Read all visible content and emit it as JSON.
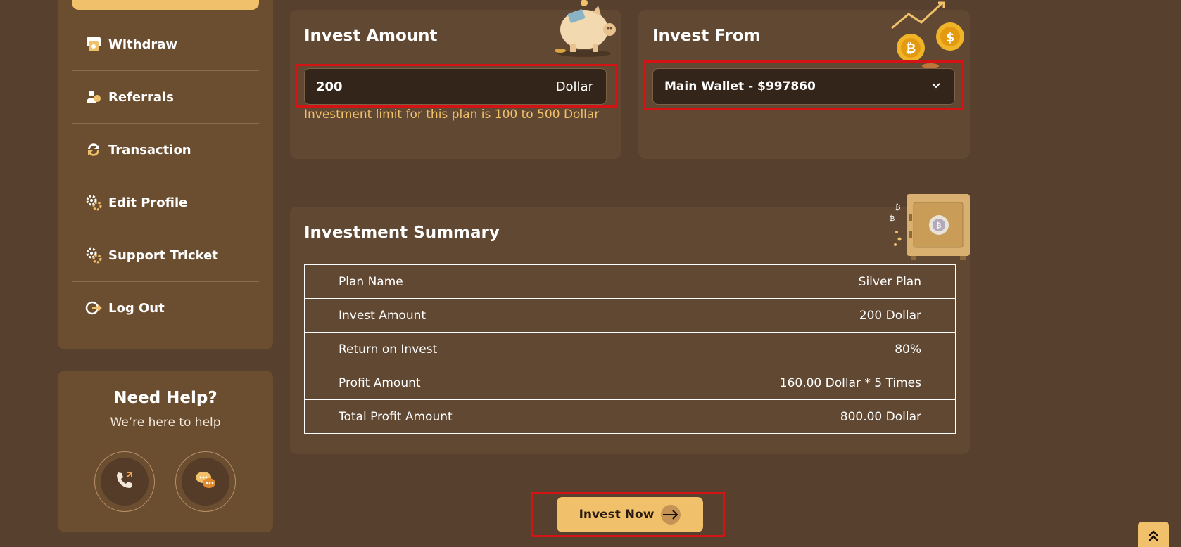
{
  "sidebar": {
    "items": [
      {
        "label": "Withdraw",
        "icon": "withdraw-icon"
      },
      {
        "label": "Referrals",
        "icon": "referrals-icon"
      },
      {
        "label": "Transaction",
        "icon": "transaction-icon"
      },
      {
        "label": "Edit Profile",
        "icon": "gear-icon"
      },
      {
        "label": "Support Tricket",
        "icon": "gear-icon"
      },
      {
        "label": "Log Out",
        "icon": "logout-icon"
      }
    ]
  },
  "help": {
    "title": "Need Help?",
    "subtitle": "We’re here to help"
  },
  "invest_amount": {
    "title": "Invest Amount",
    "value": "200",
    "unit": "Dollar",
    "limit_text": "Investment limit for this plan is 100 to 500 Dollar"
  },
  "invest_from": {
    "title": "Invest From",
    "selected": "Main Wallet - $997860"
  },
  "summary": {
    "title": "Investment Summary",
    "rows": [
      {
        "label": "Plan Name",
        "value": "Silver Plan"
      },
      {
        "label": "Invest Amount",
        "value": "200 Dollar"
      },
      {
        "label": "Return on Invest",
        "value": "80%"
      },
      {
        "label": "Profit Amount",
        "value": "160.00 Dollar * 5 Times"
      },
      {
        "label": "Total Profit Amount",
        "value": "800.00 Dollar"
      }
    ]
  },
  "invest_button": {
    "label": "Invest Now"
  },
  "colors": {
    "accent": "#f0c06a",
    "background": "#58402f",
    "card": "#614832",
    "highlight": "#d41414"
  }
}
